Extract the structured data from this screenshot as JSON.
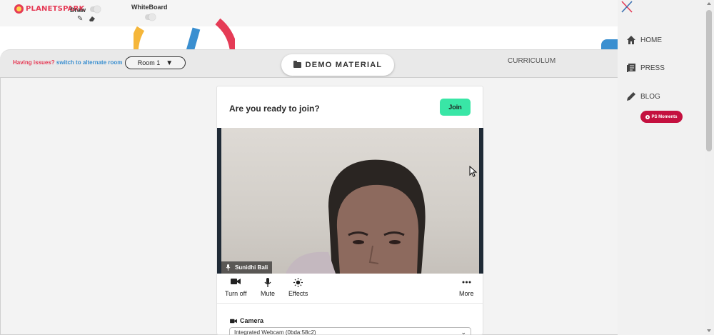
{
  "logo": {
    "text": "PLANETSPARK"
  },
  "toolbar": {
    "draw_label": "Draw",
    "whiteboard_label": "WhiteBoard"
  },
  "room_bar": {
    "issues_text": "Having issues?",
    "switch_link": "switch to alternate room",
    "room_value": "Room 1",
    "demo_material": "DEMO MATERIAL",
    "curriculum": "CURRICULUM"
  },
  "join_card": {
    "title": "Are you ready to join?",
    "join_button": "Join",
    "participant_name": "Sunidhi Bali",
    "controls": [
      {
        "label": "Turn off",
        "icon": "camera-icon"
      },
      {
        "label": "Mute",
        "icon": "microphone-icon"
      },
      {
        "label": "Effects",
        "icon": "effects-icon"
      },
      {
        "label": "More",
        "icon": "more-icon"
      }
    ],
    "camera_label": "Camera",
    "camera_device": "Integrated Webcam (0bda:58c2)"
  },
  "right_nav": {
    "items": [
      {
        "label": "HOME",
        "icon": "home-icon"
      },
      {
        "label": "PRESS",
        "icon": "press-icon"
      },
      {
        "label": "BLOG",
        "icon": "pencil-icon"
      }
    ],
    "moments_button": "PS Moments"
  },
  "colors": {
    "brand_red": "#e53b56",
    "link_blue": "#3a8fd0",
    "join_green": "#39e6a6",
    "moments_red": "#c4103f"
  }
}
